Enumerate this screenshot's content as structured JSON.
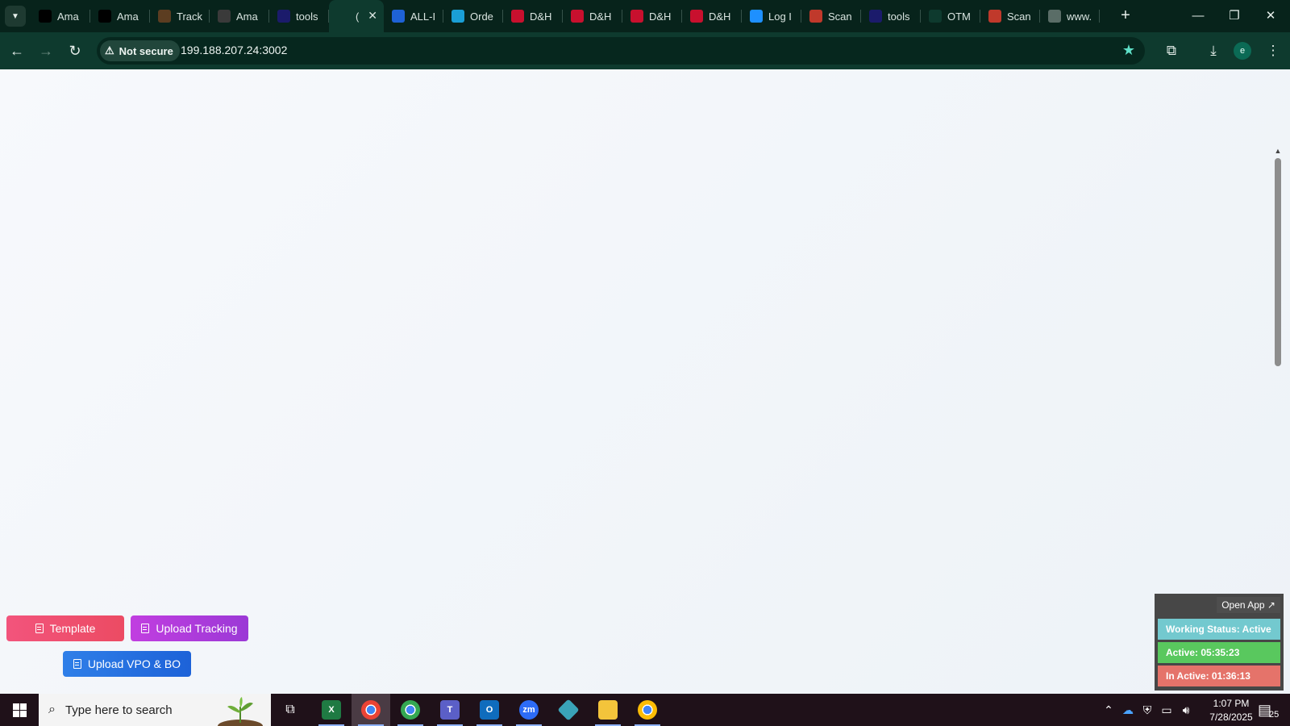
{
  "browser": {
    "tabs": [
      {
        "title": "Ama",
        "icon": "amazon-icon",
        "color": "#000000"
      },
      {
        "title": "Ama",
        "icon": "amazon-icon",
        "color": "#000000"
      },
      {
        "title": "Track",
        "icon": "ups-icon",
        "color": "#5c3d21"
      },
      {
        "title": "Ama",
        "icon": "amazon-icon",
        "color": "#3a3a3a"
      },
      {
        "title": "tools",
        "icon": "tools-icon",
        "color": "#1b1b6b"
      },
      {
        "title": "(",
        "icon": "ol-icon",
        "color": "#0e3a2e",
        "active": true
      },
      {
        "title": "ALL-I",
        "icon": "17track-icon",
        "color": "#1e62d6"
      },
      {
        "title": "Orde",
        "icon": "eg-icon",
        "color": "#1a9fd6"
      },
      {
        "title": "D&H",
        "icon": "dh-icon",
        "color": "#c8102e"
      },
      {
        "title": "D&H",
        "icon": "dh-icon",
        "color": "#c8102e"
      },
      {
        "title": "D&H",
        "icon": "dh-icon",
        "color": "#c8102e"
      },
      {
        "title": "D&H",
        "icon": "dh-icon",
        "color": "#c8102e"
      },
      {
        "title": "Log I",
        "icon": "login-icon",
        "color": "#1e90ff"
      },
      {
        "title": "Scan",
        "icon": "scan-icon",
        "color": "#c0392b"
      },
      {
        "title": "tools",
        "icon": "tools-icon",
        "color": "#1b1b6b"
      },
      {
        "title": "OTM",
        "icon": "ol-icon",
        "color": "#0e3a2e"
      },
      {
        "title": "Scan",
        "icon": "scan-icon",
        "color": "#c0392b"
      },
      {
        "title": "www.",
        "icon": "globe-icon",
        "color": "#5a6d67"
      }
    ],
    "security_label": "Not secure",
    "url": "199.188.207.24:3002",
    "profile_initial": "e"
  },
  "page": {
    "buttons": {
      "template": "Template",
      "upload_tracking": "Upload Tracking",
      "upload_vpo": "Upload VPO & BO"
    },
    "status_widget": {
      "open_app": "Open App ↗",
      "working_status": "Working Status: Active",
      "active": "Active: 05:35:23",
      "inactive": "In Active: 01:36:13"
    }
  },
  "taskbar": {
    "search_placeholder": "Type here to search",
    "time": "1:07 PM",
    "date": "7/28/2025",
    "notification_count": "25"
  }
}
